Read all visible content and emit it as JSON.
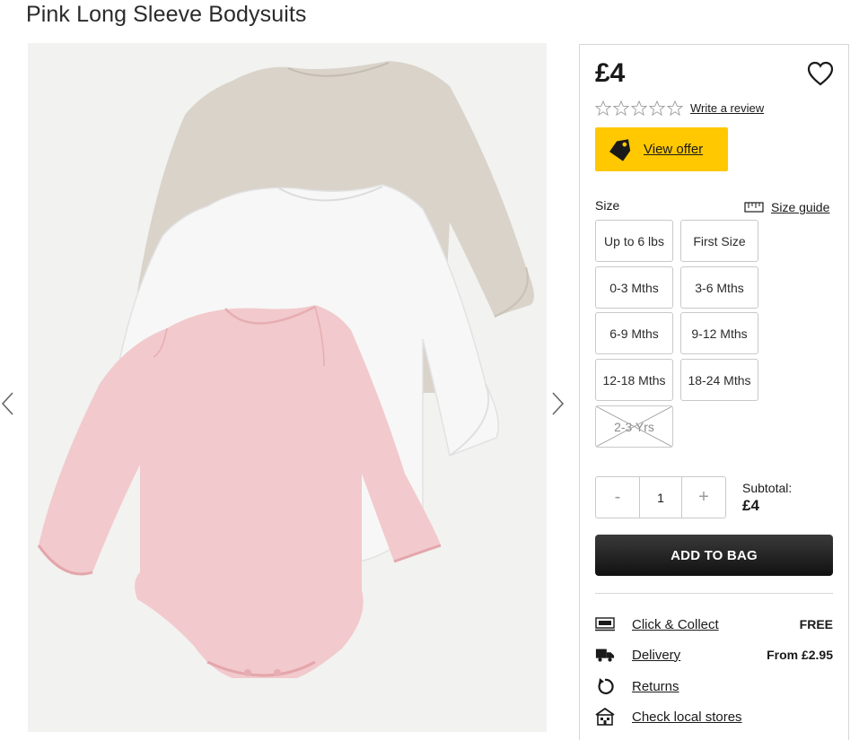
{
  "product": {
    "title": "Pink Long Sleeve Bodysuits",
    "price": "£4"
  },
  "rating": {
    "stars_filled": 0,
    "stars_total": 5,
    "review_link": "Write a review"
  },
  "offer": {
    "label": "View offer",
    "color": "#ffc800"
  },
  "size": {
    "label": "Size",
    "guide_label": "Size guide",
    "options": [
      {
        "label": "Up to 6 lbs",
        "available": true
      },
      {
        "label": "First Size",
        "available": true
      },
      {
        "label": "0-3 Mths",
        "available": true
      },
      {
        "label": "3-6 Mths",
        "available": true
      },
      {
        "label": "6-9 Mths",
        "available": true
      },
      {
        "label": "9-12 Mths",
        "available": true
      },
      {
        "label": "12-18 Mths",
        "available": true
      },
      {
        "label": "18-24 Mths",
        "available": true
      },
      {
        "label": "2-3 Yrs",
        "available": false
      }
    ]
  },
  "quantity": {
    "minus": "-",
    "value": "1",
    "plus": "+"
  },
  "subtotal": {
    "label": "Subtotal:",
    "value": "£4"
  },
  "add_to_bag": {
    "label": "ADD TO BAG"
  },
  "services": [
    {
      "icon": "click-collect-icon",
      "link": "Click & Collect",
      "value": "FREE"
    },
    {
      "icon": "delivery-truck-icon",
      "link": "Delivery",
      "value": "From £2.95"
    },
    {
      "icon": "returns-icon",
      "link": "Returns",
      "value": ""
    },
    {
      "icon": "store-icon",
      "link": "Check local stores",
      "value": ""
    }
  ],
  "colors": {
    "button_dark": "#1a1a1a",
    "border": "#c9c9c9"
  }
}
